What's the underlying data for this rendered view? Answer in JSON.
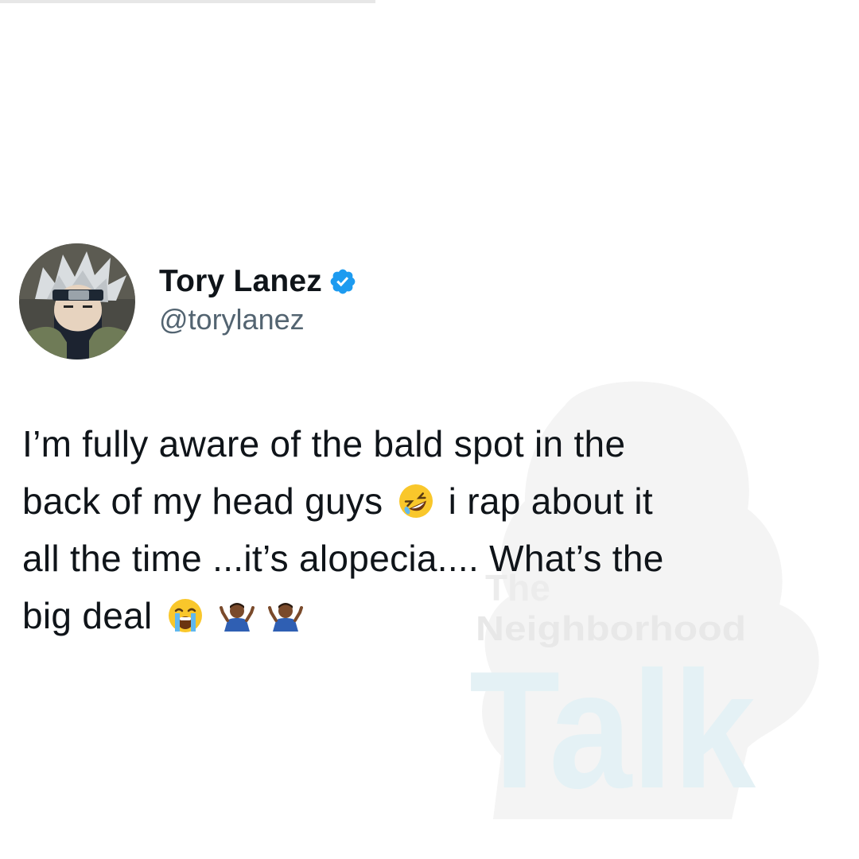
{
  "tweet": {
    "display_name": "Tory Lanez",
    "handle": "@torylanez",
    "verified": true,
    "avatar_icon": "anime-character-avatar",
    "badge_icon": "verified-badge-icon",
    "badge_color": "#1d9bf0",
    "text_lines": [
      {
        "before": "I’m fully aware of the bald spot in the",
        "after": ""
      },
      {
        "before": "back of my head guys",
        "after": "i rap about it"
      },
      {
        "before": "all the time ...it’s alopecia.... What’s the",
        "after": ""
      },
      {
        "before": "big deal",
        "after": ""
      }
    ],
    "emojis": [
      "rolling-on-floor-laughing-emoji",
      "loudly-crying-emoji",
      "person-shrugging-emoji",
      "person-shrugging-emoji"
    ]
  },
  "watermark": {
    "line1": "The",
    "line2": "Neighborhood",
    "line3": "Talk"
  },
  "colors": {
    "text": "#0f1419",
    "handle": "#536471",
    "verified": "#1d9bf0",
    "watermark_shadow": "#f2f2f2",
    "watermark_talk": "#e6f3f7"
  }
}
